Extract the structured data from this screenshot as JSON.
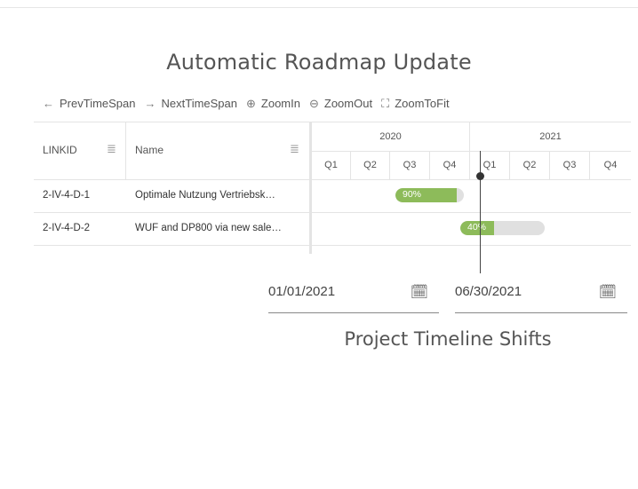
{
  "title": "Automatic Roadmap Update",
  "subtitle": "Project Timeline Shifts",
  "toolbar": {
    "buttons": [
      {
        "label": "PrevTimeSpan",
        "icon": "arrow-left-icon",
        "glyph": "←"
      },
      {
        "label": "NextTimeSpan",
        "icon": "arrow-right-icon",
        "glyph": "→"
      },
      {
        "label": "ZoomIn",
        "icon": "zoom-in-icon",
        "glyph": "⊕"
      },
      {
        "label": "ZoomOut",
        "icon": "zoom-out-icon",
        "glyph": "⊖"
      },
      {
        "label": "ZoomToFit",
        "icon": "zoom-to-fit-icon",
        "glyph": "⛶"
      }
    ]
  },
  "grid": {
    "columns": [
      {
        "label": "LINKID"
      },
      {
        "label": "Name"
      }
    ],
    "rows": [
      {
        "linkid": "2-IV-4-D-1",
        "name": "Optimale Nutzung Vertriebsk…",
        "progress_label": "90%",
        "progress": 0.9
      },
      {
        "linkid": "2-IV-4-D-2",
        "name": "WUF and DP800 via new sale…",
        "progress_label": "40%",
        "progress": 0.4
      }
    ]
  },
  "timeline": {
    "years": [
      "2020",
      "2021"
    ],
    "quarters": [
      "Q1",
      "Q2",
      "Q3",
      "Q4",
      "Q1",
      "Q2",
      "Q3",
      "Q4"
    ]
  },
  "date_fields": {
    "start": "01/01/2021",
    "end": "06/30/2021"
  },
  "colors": {
    "progress_fill": "#8dbb5a",
    "progress_track": "#e0e0e0",
    "marker": "#333333"
  }
}
